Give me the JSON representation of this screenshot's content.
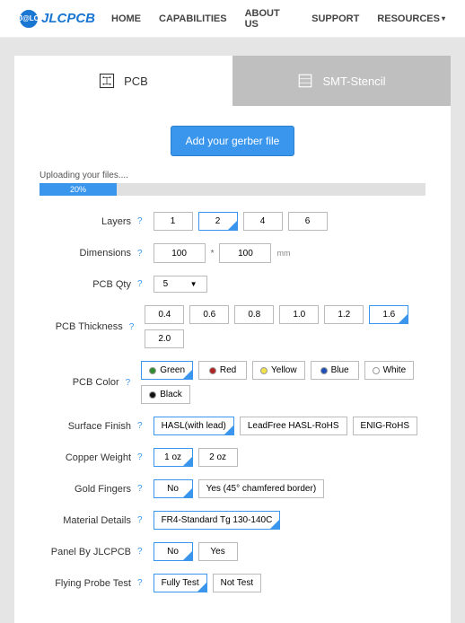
{
  "brand": "JLCPCB",
  "nav": [
    "HOME",
    "CAPABILITIES",
    "ABOUT US",
    "SUPPORT",
    "RESOURCES"
  ],
  "tabs": {
    "pcb": "PCB",
    "stencil": "SMT-Stencil"
  },
  "upload_button": "Add your gerber file",
  "uploading_text": "Uploading your files....",
  "progress_label": "20%",
  "labels": {
    "layers": "Layers",
    "dimensions": "Dimensions",
    "qty": "PCB Qty",
    "thickness": "PCB Thickness",
    "color": "PCB Color",
    "surface": "Surface Finish",
    "copper": "Copper Weight",
    "gold": "Gold Fingers",
    "material": "Material Details",
    "panel": "Panel By JLCPCB",
    "probe": "Flying Probe Test"
  },
  "layers": {
    "opts": [
      "1",
      "2",
      "4",
      "6"
    ],
    "sel": "2"
  },
  "dimensions": {
    "w": "100",
    "h": "100",
    "unit": "mm"
  },
  "qty": "5",
  "thickness": {
    "opts": [
      "0.4",
      "0.6",
      "0.8",
      "1.0",
      "1.2",
      "1.6",
      "2.0"
    ],
    "sel": "1.6"
  },
  "colors": [
    {
      "name": "Green",
      "hex": "#2e8b2e",
      "sel": true
    },
    {
      "name": "Red",
      "hex": "#b22222",
      "sel": false
    },
    {
      "name": "Yellow",
      "hex": "#f2e24b",
      "sel": false
    },
    {
      "name": "Blue",
      "hex": "#1e4fb7",
      "sel": false
    },
    {
      "name": "White",
      "hex": "#ffffff",
      "sel": false
    },
    {
      "name": "Black",
      "hex": "#111111",
      "sel": false
    }
  ],
  "surface": {
    "opts": [
      "HASL(with lead)",
      "LeadFree HASL-RoHS",
      "ENIG-RoHS"
    ],
    "sel": "HASL(with lead)"
  },
  "copper": {
    "opts": [
      "1 oz",
      "2 oz"
    ],
    "sel": "1 oz"
  },
  "gold": {
    "opts": [
      "No",
      "Yes (45° chamfered border)"
    ],
    "sel": "No"
  },
  "material": {
    "opts": [
      "FR4-Standard Tg 130-140C"
    ],
    "sel": "FR4-Standard Tg 130-140C"
  },
  "panel": {
    "opts": [
      "No",
      "Yes"
    ],
    "sel": "No"
  },
  "probe": {
    "opts": [
      "Fully Test",
      "Not Test"
    ],
    "sel": "Fully Test"
  }
}
